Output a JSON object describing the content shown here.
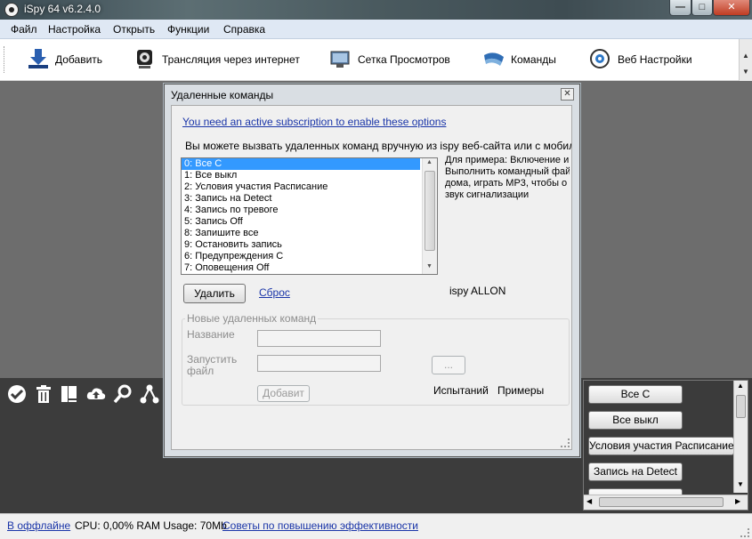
{
  "window": {
    "title": "iSpy 64 v6.2.4.0",
    "minimize": "—",
    "maximize": "□",
    "close": "✕"
  },
  "menu": [
    "Файл",
    "Настройка",
    "Открыть",
    "Функции",
    "Справка"
  ],
  "toolbar": [
    {
      "label": "Добавить",
      "icon": "add-download-icon"
    },
    {
      "label": "Трансляция через интернет",
      "icon": "webcam-icon"
    },
    {
      "label": "Сетка Просмотров",
      "icon": "grid-view-icon"
    },
    {
      "label": "Команды",
      "icon": "commands-icon"
    },
    {
      "label": "Веб Настройки",
      "icon": "web-settings-icon"
    }
  ],
  "side_icons": [
    "check-icon",
    "trash-icon",
    "book-icon",
    "cloud-upload-icon",
    "search-icon",
    "network-icon"
  ],
  "cmd_panel": {
    "buttons": [
      "Все C",
      "Все выкл",
      "Условия участия Расписание",
      "Запись на Detect"
    ]
  },
  "status": {
    "offline_link": "В оффлайне",
    "stats": "CPU: 0,00% RAM Usage: 70Mb",
    "tips_link": "Советы по повышению эффективности"
  },
  "dialog": {
    "title": "Удаленные команды",
    "close": "✕",
    "subscription_link": "You need an active subscription to enable these options",
    "description": "Вы можете вызвать удаленных команд вручную из ispy веб-сайта или с мобильных у",
    "commands": [
      "0: Все C",
      "1: Все выкл",
      "2: Условия участия Расписание",
      "3: Запись на Detect",
      "4: Запись по тревоге",
      "5: Запись Off",
      "8: Запишите все",
      "9: Остановить запись",
      "6: Предупреждения C",
      "7: Оповещения Off"
    ],
    "selected_index": 0,
    "example_lines": [
      "Для примера: Включение и",
      "Выполнить командный фай",
      "дома, играть MP3, чтобы о",
      "звук сигнализации"
    ],
    "delete_button": "Удалить",
    "reset_link": "Сброс",
    "ispy_command": "ispy ALLON",
    "new_group_title": "Новые удаленных команд",
    "name_label": "Название",
    "run_file_label_1": "Запустить",
    "run_file_label_2": "файл",
    "browse_button": "...",
    "add_button": "Добавит",
    "test_label": "Испытаний",
    "examples_label": "Примеры"
  }
}
